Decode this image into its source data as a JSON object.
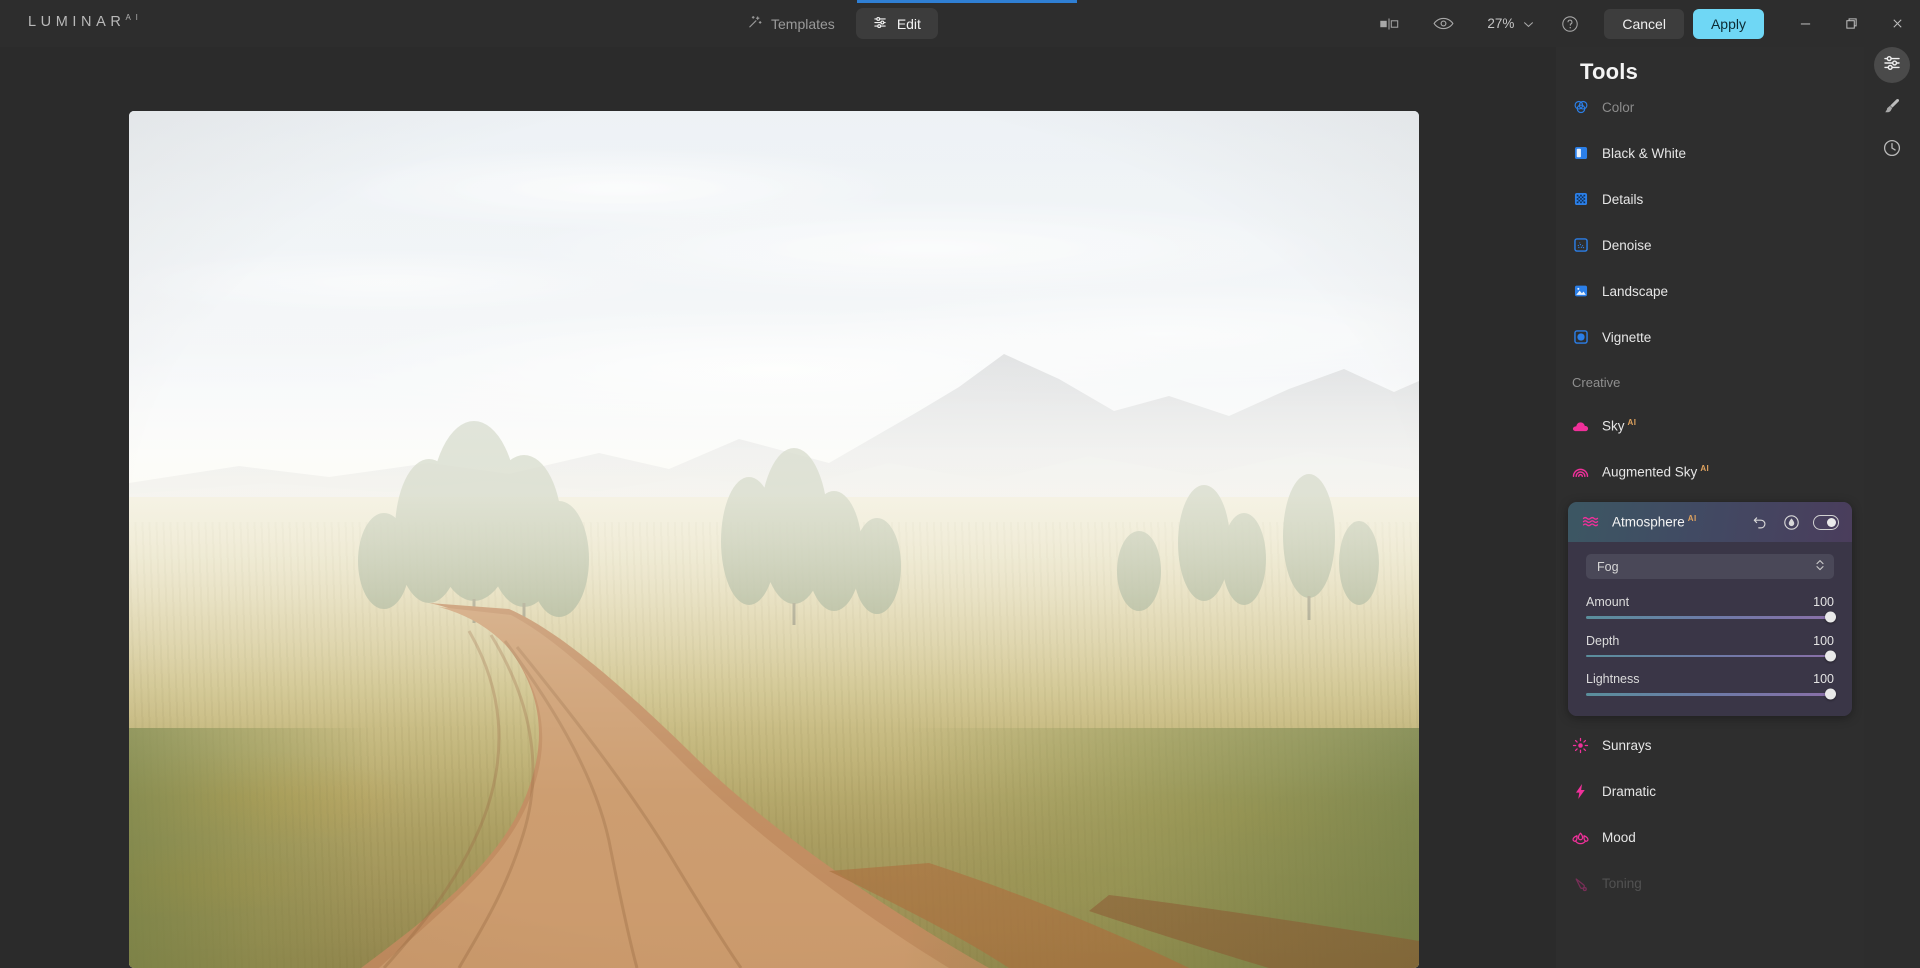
{
  "app": {
    "brand": "LUMINAR",
    "brand_sup": "A I",
    "accent_blue": "#2f7fd4",
    "apply_color": "#6fd7f5",
    "icon_blue": "#2b7fe8",
    "icon_pink": "#f0309a",
    "ai_badge_color": "#e0a35e"
  },
  "topbar": {
    "templates_label": "Templates",
    "templates_icon": "magic-wand-icon",
    "edit_label": "Edit",
    "edit_icon": "sliders-icon",
    "compare_icon": "compare-split-icon",
    "preview_icon": "eye-icon",
    "zoom_value": "27%",
    "zoom_chevron_icon": "chevron-down-icon",
    "help_icon": "question-circle-icon",
    "cancel_label": "Cancel",
    "apply_label": "Apply",
    "minimize_icon": "window-minimize-icon",
    "maximize_icon": "window-restore-icon",
    "close_icon": "window-close-icon"
  },
  "panel": {
    "title": "Tools",
    "essential_tools": [
      {
        "label": "Color",
        "icon": "color-circles-icon",
        "dim": true
      },
      {
        "label": "Black & White",
        "icon": "black-white-split-icon",
        "dim": false
      },
      {
        "label": "Details",
        "icon": "details-checker-icon",
        "dim": false
      },
      {
        "label": "Denoise",
        "icon": "denoise-grain-icon",
        "dim": false
      },
      {
        "label": "Landscape",
        "icon": "landscape-picture-icon",
        "dim": false
      },
      {
        "label": "Vignette",
        "icon": "vignette-circle-icon",
        "dim": false
      }
    ],
    "creative_header": "Creative",
    "creative_top": [
      {
        "label": "Sky",
        "icon": "cloud-icon",
        "ai": "AI"
      },
      {
        "label": "Augmented Sky",
        "icon": "arc-rainbow-icon",
        "ai": "AI"
      }
    ],
    "creative_bottom": [
      {
        "label": "Sunrays",
        "icon": "sun-burst-icon",
        "ai": "",
        "dim": false
      },
      {
        "label": "Dramatic",
        "icon": "lightning-bolt-icon",
        "ai": "",
        "dim": false
      },
      {
        "label": "Mood",
        "icon": "lotus-flower-icon",
        "ai": "",
        "dim": false
      },
      {
        "label": "Toning",
        "icon": "toning-flask-icon",
        "ai": "",
        "dim": true
      }
    ]
  },
  "atmosphere": {
    "title": "Atmosphere",
    "ai_badge": "AI",
    "header_icon": "waves-icon",
    "reset_icon": "undo-arrow-icon",
    "mask_icon": "mask-brush-icon",
    "toggle_icon": "toggle-switch-on-icon",
    "effect_label": "Fog",
    "effect_chevrons_icon": "chevron-updown-icon",
    "sliders": [
      {
        "name": "Amount",
        "value": "100",
        "fill": 100
      },
      {
        "name": "Depth",
        "value": "100",
        "fill": 100
      },
      {
        "name": "Lightness",
        "value": "100",
        "fill": 100
      }
    ]
  },
  "rail": {
    "items": [
      {
        "icon": "adjustments-sliders-icon",
        "active": true
      },
      {
        "icon": "brush-icon",
        "active": false
      },
      {
        "icon": "history-clock-icon",
        "active": false
      }
    ]
  },
  "canvas": {
    "photo_alt": "foggy-grassland-dirt-road-photo"
  }
}
